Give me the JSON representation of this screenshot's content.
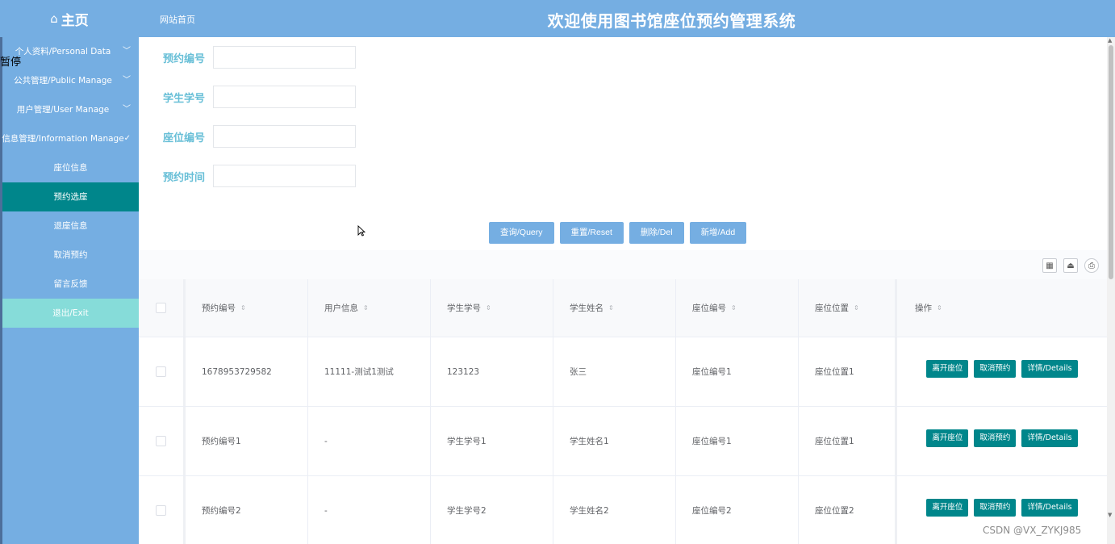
{
  "header": {
    "brand": "主页",
    "breadcrumb": "网站首页",
    "title": "欢迎使用图书馆座位预约管理系统"
  },
  "sidebar": {
    "overlay": "暂停",
    "groups": [
      {
        "label": "个人资料/Personal Data"
      },
      {
        "label": "公共管理/Public Manage"
      },
      {
        "label": "用户管理/User Manage"
      },
      {
        "label": "信息管理/Information Manage"
      }
    ],
    "items": [
      {
        "label": "座位信息"
      },
      {
        "label": "预约选座"
      },
      {
        "label": "退座信息"
      },
      {
        "label": "取消预约"
      },
      {
        "label": "留言反馈"
      },
      {
        "label": "退出/Exit"
      }
    ]
  },
  "search": {
    "fields": [
      {
        "label": "预约编号",
        "value": ""
      },
      {
        "label": "学生学号",
        "value": ""
      },
      {
        "label": "座位编号",
        "value": ""
      },
      {
        "label": "预约时间",
        "value": ""
      }
    ],
    "buttons": {
      "query": "查询/Query",
      "reset": "重置/Reset",
      "delete": "删除/Del",
      "add": "新增/Add"
    }
  },
  "table": {
    "columns": [
      "预约编号",
      "用户信息",
      "学生学号",
      "学生姓名",
      "座位编号",
      "座位位置",
      "操作"
    ],
    "rows": [
      {
        "reservation_no": "1678953729582",
        "user_info": "11111-测试1测试",
        "student_no": "123123",
        "student_name": "张三",
        "seat_no": "座位编号1",
        "seat_location": "座位位置1"
      },
      {
        "reservation_no": "预约编号1",
        "user_info": "-",
        "student_no": "学生学号1",
        "student_name": "学生姓名1",
        "seat_no": "座位编号1",
        "seat_location": "座位位置1"
      },
      {
        "reservation_no": "预约编号2",
        "user_info": "-",
        "student_no": "学生学号2",
        "student_name": "学生姓名2",
        "seat_no": "座位编号2",
        "seat_location": "座位位置2"
      }
    ],
    "actions": {
      "leave": "离开座位",
      "cancel": "取消预约",
      "details": "详情/Details"
    }
  },
  "watermark": "CSDN @VX_ZYKJ985",
  "colors": {
    "primary": "#75aee2",
    "teal": "#00868b",
    "exit": "#86dcd9",
    "label": "#68bfd7"
  }
}
